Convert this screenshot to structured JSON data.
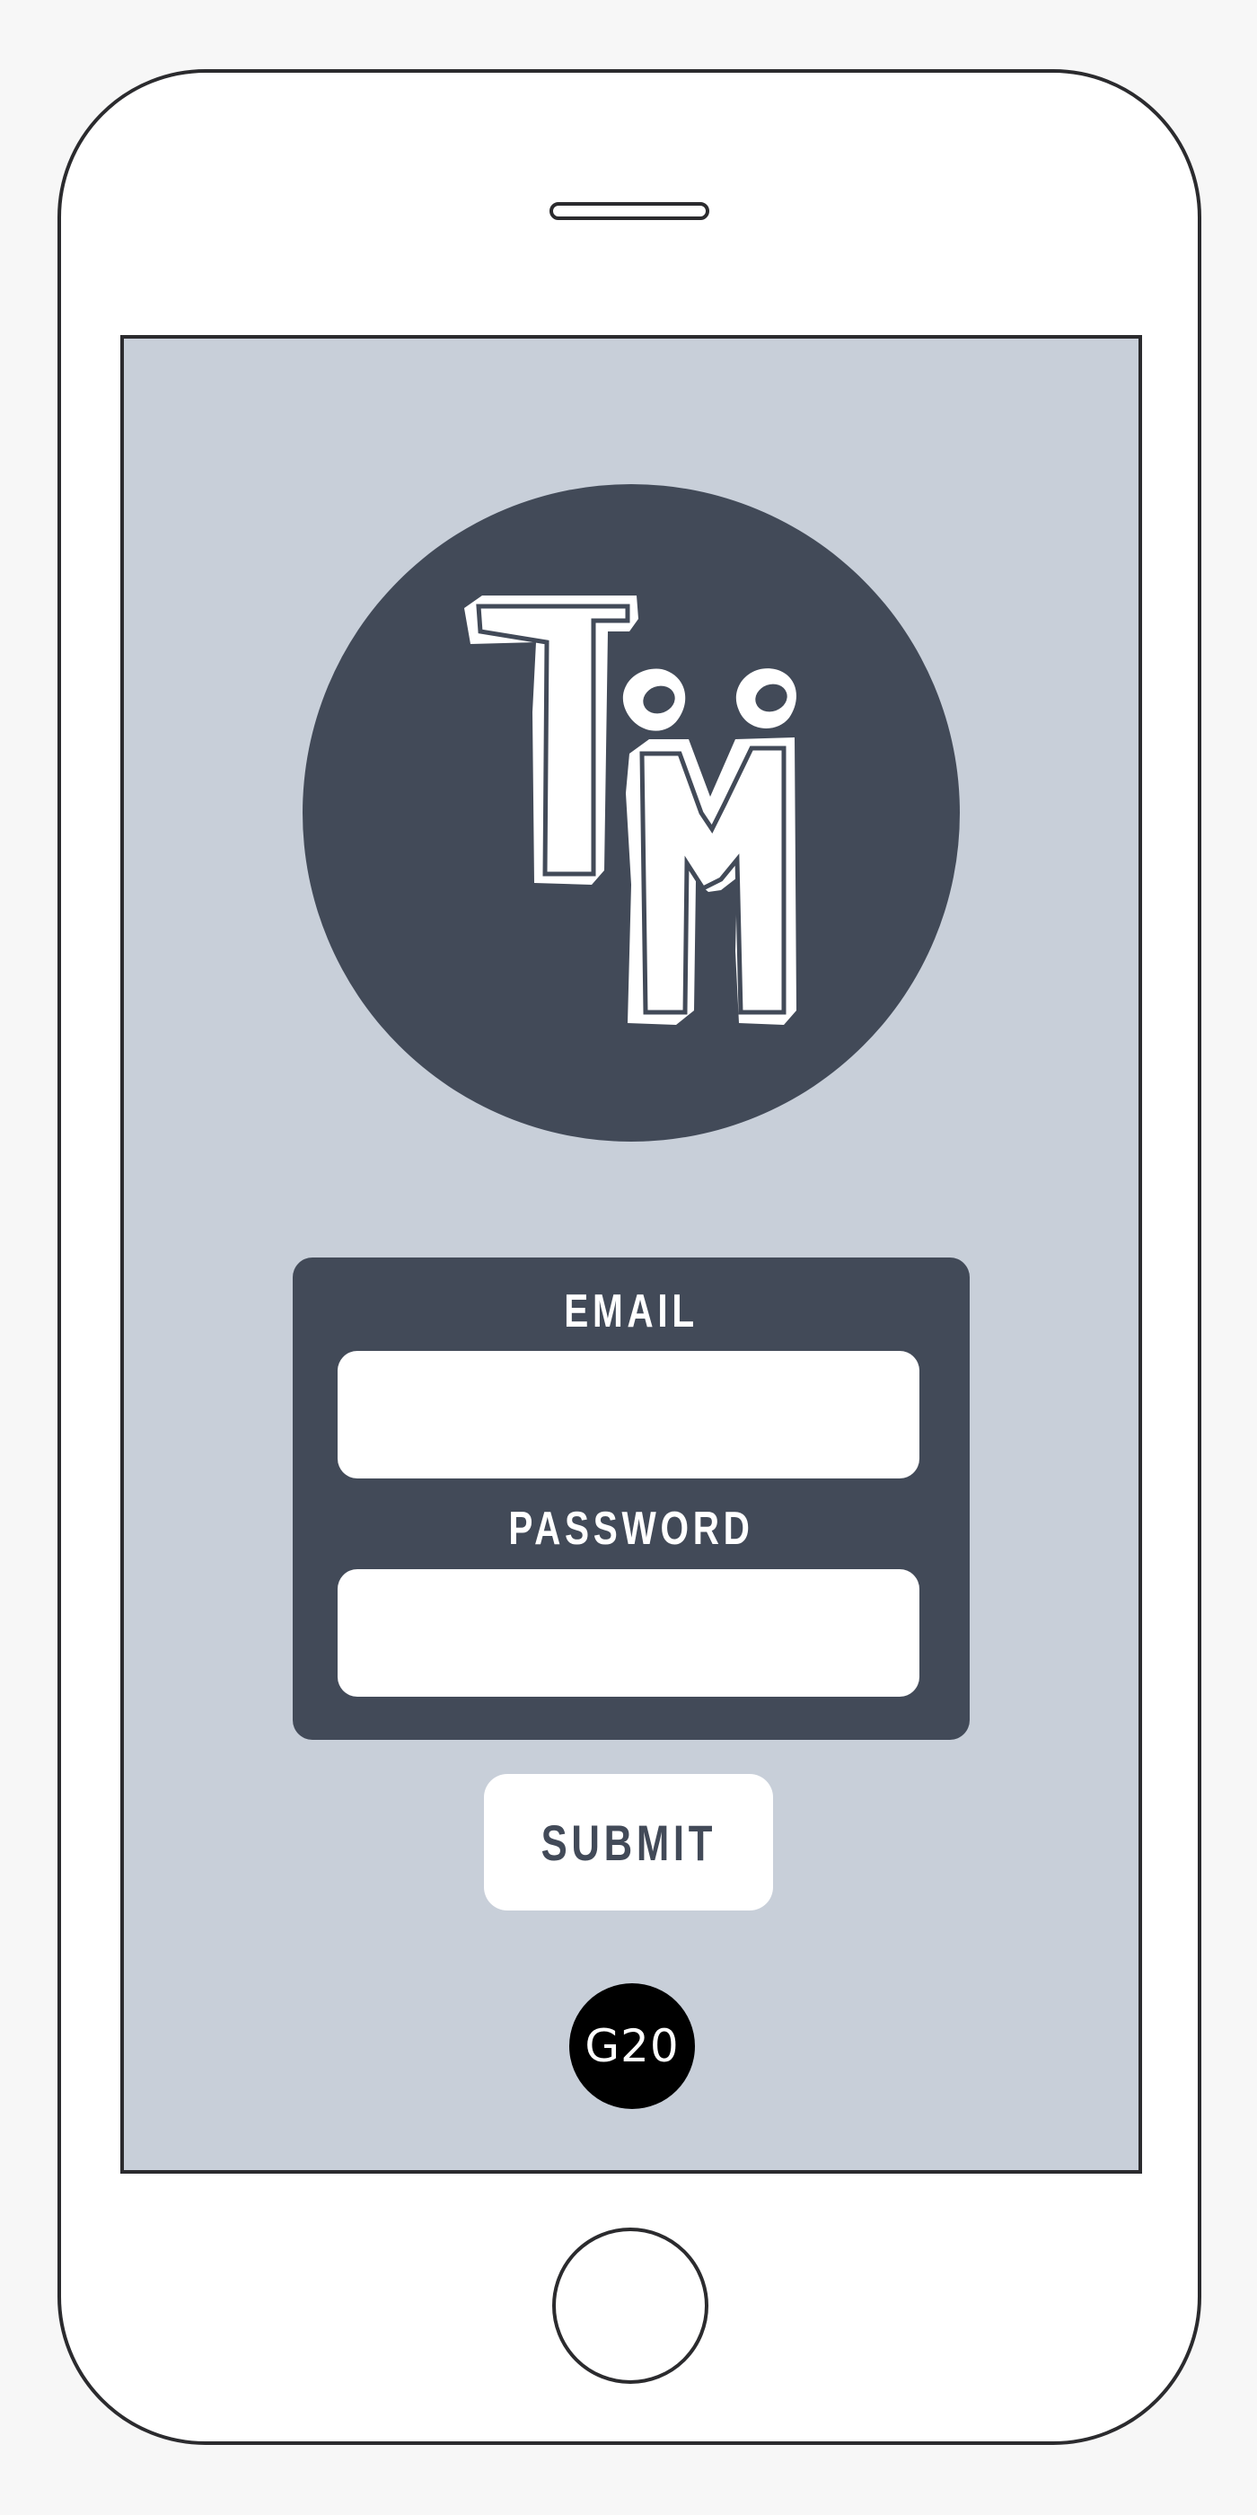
{
  "app": {
    "logo_text": "TM",
    "logo_icon": "tm-monogram-icon"
  },
  "login_form": {
    "email_label": "EMAIL",
    "email_value": "",
    "password_label": "PASSWORD",
    "password_value": "",
    "submit_label": "SUBMIT"
  },
  "footer": {
    "badge_text": "G20"
  },
  "colors": {
    "screen_background": "#c8cfd9",
    "panel": "#424a58",
    "badge": "#000000",
    "frame": "#2b2b2e"
  }
}
